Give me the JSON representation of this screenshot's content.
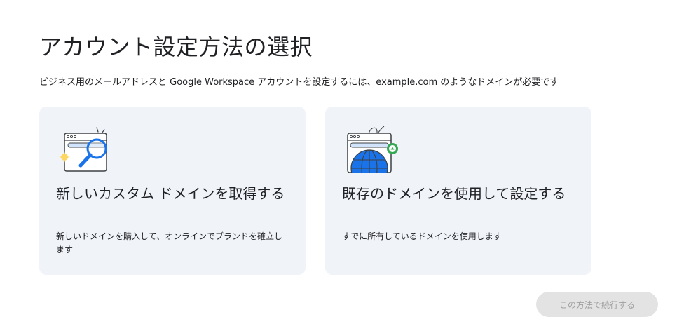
{
  "header": {
    "title": "アカウント設定方法の選択",
    "subtitle_before": "ビジネス用のメールアドレスと Google Workspace アカウントを設定するには、example.com のような",
    "subtitle_link": "ドメイン",
    "subtitle_after": "が必要です"
  },
  "options": [
    {
      "icon": "search-domain-illustration",
      "title": "新しいカスタム ドメインを取得する",
      "description": "新しいドメインを購入して、オンラインでブランドを確立します"
    },
    {
      "icon": "globe-domain-illustration",
      "title": "既存のドメインを使用して設定する",
      "description": "すでに所有しているドメインを使用します"
    }
  ],
  "footer": {
    "continue_label": "この方法で続行する"
  },
  "colors": {
    "card_background": "#f0f4f9",
    "accent_blue": "#1a73e8",
    "disabled_button": "#e3e3e3",
    "disabled_text": "#a0a0a0"
  }
}
